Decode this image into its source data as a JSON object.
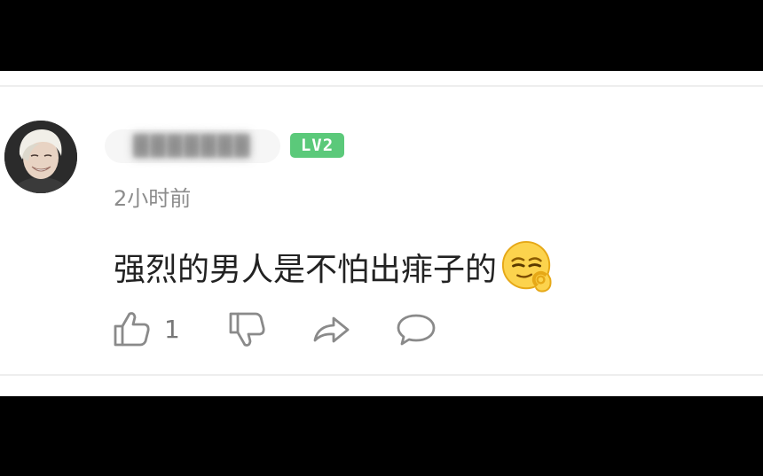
{
  "comment": {
    "author": {
      "name": "███████"
    },
    "level_badge": "LV2",
    "timestamp": "2小时前",
    "text": "强烈的男人是不怕出痱子的",
    "emoji": "smirk-ok-hand-emoji"
  },
  "actions": {
    "like_count": "1",
    "icons": [
      "thumbs-up-icon",
      "thumbs-down-icon",
      "share-icon",
      "reply-icon"
    ]
  },
  "colors": {
    "background_bars": "#000000",
    "card": "#ffffff",
    "level_badge": "#5bc97a",
    "timestamp": "#8c8c8c",
    "icon_stroke": "#8a8a8a"
  }
}
